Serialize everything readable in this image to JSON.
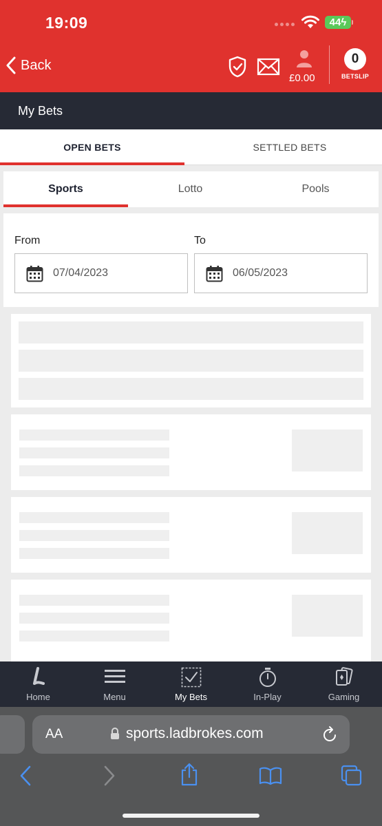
{
  "status_bar": {
    "time": "19:09",
    "battery": "44"
  },
  "header": {
    "back_label": "Back",
    "balance": "£0.00",
    "betslip_count": "0",
    "betslip_label": "BETSLIP",
    "accent_color": "#e0322e"
  },
  "page": {
    "title": "My Bets"
  },
  "main_tabs": [
    {
      "label": "OPEN BETS",
      "active": true
    },
    {
      "label": "SETTLED BETS",
      "active": false
    }
  ],
  "sub_tabs": [
    {
      "label": "Sports",
      "active": true
    },
    {
      "label": "Lotto",
      "active": false
    },
    {
      "label": "Pools",
      "active": false
    }
  ],
  "date_filter": {
    "from_label": "From",
    "from_value": "07/04/2023",
    "to_label": "To",
    "to_value": "06/05/2023",
    "icon": "calendar-icon"
  },
  "bottom_nav": [
    {
      "label": "Home",
      "icon": "ladbrokes-logo-icon"
    },
    {
      "label": "Menu",
      "icon": "hamburger-icon"
    },
    {
      "label": "My Bets",
      "icon": "checkbox-icon",
      "active": true
    },
    {
      "label": "In-Play",
      "icon": "stopwatch-icon"
    },
    {
      "label": "Gaming",
      "icon": "cards-icon"
    }
  ],
  "browser": {
    "text_size_label": "AA",
    "url": "sports.ladbrokes.com"
  }
}
